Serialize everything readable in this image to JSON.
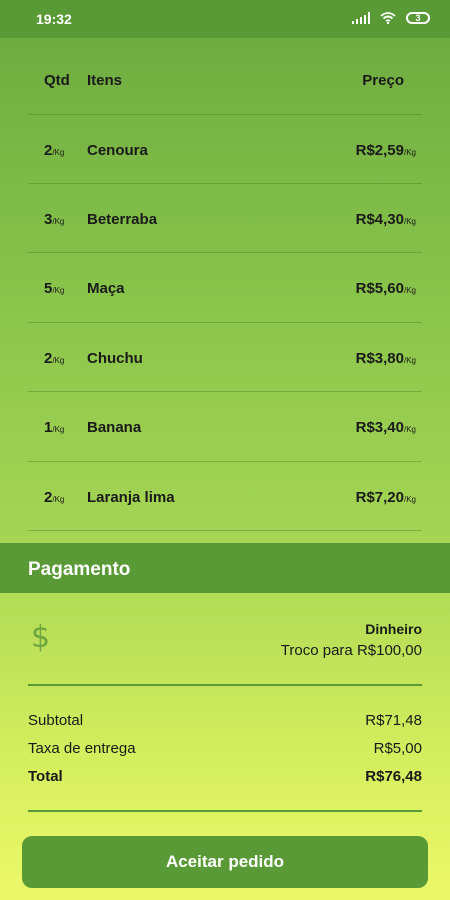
{
  "status_bar": {
    "time": "19:32",
    "battery_level": "3",
    "icons": [
      "signal-icon",
      "wifi-icon",
      "battery-icon"
    ]
  },
  "table": {
    "headers": {
      "qty": "Qtd",
      "items": "Itens",
      "price": "Preço"
    },
    "unit": "/Kg",
    "rows": [
      {
        "qty": "2",
        "name": "Cenoura",
        "price": "R$2,59"
      },
      {
        "qty": "3",
        "name": "Beterraba",
        "price": "R$4,30"
      },
      {
        "qty": "5",
        "name": "Maça",
        "price": "R$5,60"
      },
      {
        "qty": "2",
        "name": "Chuchu",
        "price": "R$3,80"
      },
      {
        "qty": "1",
        "name": "Banana",
        "price": "R$3,40"
      },
      {
        "qty": "2",
        "name": "Laranja lima",
        "price": "R$7,20"
      }
    ]
  },
  "payment": {
    "title": "Pagamento",
    "icon": "dollar-icon",
    "method": "Dinheiro",
    "change": "Troco para R$100,00"
  },
  "summary": {
    "subtotal_label": "Subtotal",
    "subtotal_value": "R$71,48",
    "fee_label": "Taxa de entrega",
    "fee_value": "R$5,00",
    "total_label": "Total",
    "total_value": "R$76,48"
  },
  "action": {
    "accept_label": "Aceitar pedido"
  },
  "colors": {
    "primary": "#5a9a36",
    "gradient_top": "#6ba93f",
    "gradient_bottom": "#ecf86a"
  }
}
